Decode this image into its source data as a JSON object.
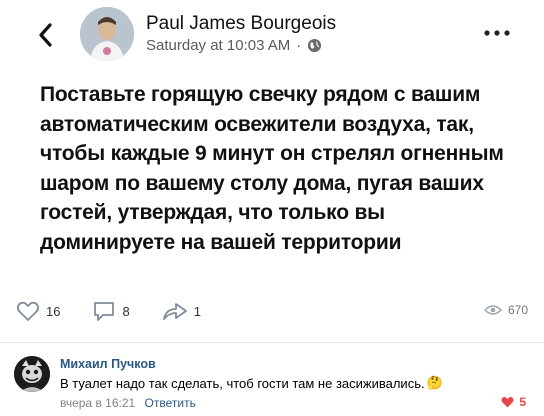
{
  "post": {
    "author": "Paul James Bourgeois",
    "timestamp": "Saturday at 10:03 AM",
    "separator": "·",
    "text": "Поставьте горящую свечку рядом с вашим автоматическим освежители воздуха, так, чтобы каждые 9 минут он стрелял огненным шаром по вашему столу дома, пугая ваших гостей, утверждая, что только вы доминируете на вашей территории"
  },
  "actions": {
    "likes": "16",
    "comments": "8",
    "shares": "1",
    "views": "670"
  },
  "comment": {
    "author": "Михаил Пучков",
    "text": "В туалет надо так сделать, чтоб гости там не засиживались.",
    "emoji": "🤔",
    "time": "вчера в 16:21",
    "reply_label": "Ответить",
    "likes": "5"
  },
  "colors": {
    "link": "#2a5885",
    "like_red": "#e64646"
  },
  "icons": [
    "back-arrow-icon",
    "globe-icon",
    "more-dots-icon",
    "heart-icon",
    "comment-icon",
    "share-icon",
    "eye-icon"
  ]
}
